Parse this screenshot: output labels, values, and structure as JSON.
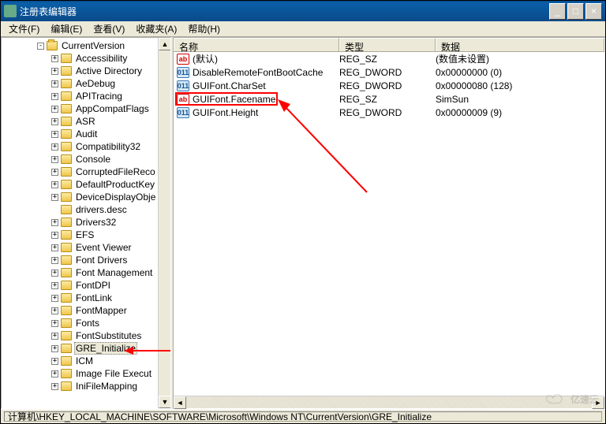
{
  "window": {
    "title": "注册表编辑器"
  },
  "menu": {
    "file": "文件(F)",
    "edit": "编辑(E)",
    "view": "查看(V)",
    "favorites": "收藏夹(A)",
    "help": "帮助(H)"
  },
  "tree": {
    "root": "CurrentVersion",
    "items": [
      "Accessibility",
      "Active Directory",
      "AeDebug",
      "APITracing",
      "AppCompatFlags",
      "ASR",
      "Audit",
      "Compatibility32",
      "Console",
      "CorruptedFileReco",
      "DefaultProductKey",
      "DeviceDisplayObje",
      "drivers.desc",
      "Drivers32",
      "EFS",
      "Event Viewer",
      "Font Drivers",
      "Font Management",
      "FontDPI",
      "FontLink",
      "FontMapper",
      "Fonts",
      "FontSubstitutes",
      "GRE_Initialize",
      "ICM",
      "Image File Execut",
      "IniFileMapping"
    ],
    "selected": "GRE_Initialize"
  },
  "list": {
    "headers": {
      "name": "名称",
      "type": "类型",
      "data": "数据"
    },
    "rows": [
      {
        "icon": "sz",
        "name": "(默认)",
        "type": "REG_SZ",
        "data": "(数值未设置)"
      },
      {
        "icon": "dw",
        "name": "DisableRemoteFontBootCache",
        "type": "REG_DWORD",
        "data": "0x00000000 (0)"
      },
      {
        "icon": "dw",
        "name": "GUIFont.CharSet",
        "type": "REG_DWORD",
        "data": "0x00000080 (128)"
      },
      {
        "icon": "sz",
        "name": "GUIFont.Facename",
        "type": "REG_SZ",
        "data": "SimSun"
      },
      {
        "icon": "dw",
        "name": "GUIFont.Height",
        "type": "REG_DWORD",
        "data": "0x00000009 (9)"
      }
    ],
    "highlighted_row_index": 3
  },
  "statusbar": {
    "path": "计算机\\HKEY_LOCAL_MACHINE\\SOFTWARE\\Microsoft\\Windows NT\\CurrentVersion\\GRE_Initialize"
  },
  "watermark": "亿速云"
}
